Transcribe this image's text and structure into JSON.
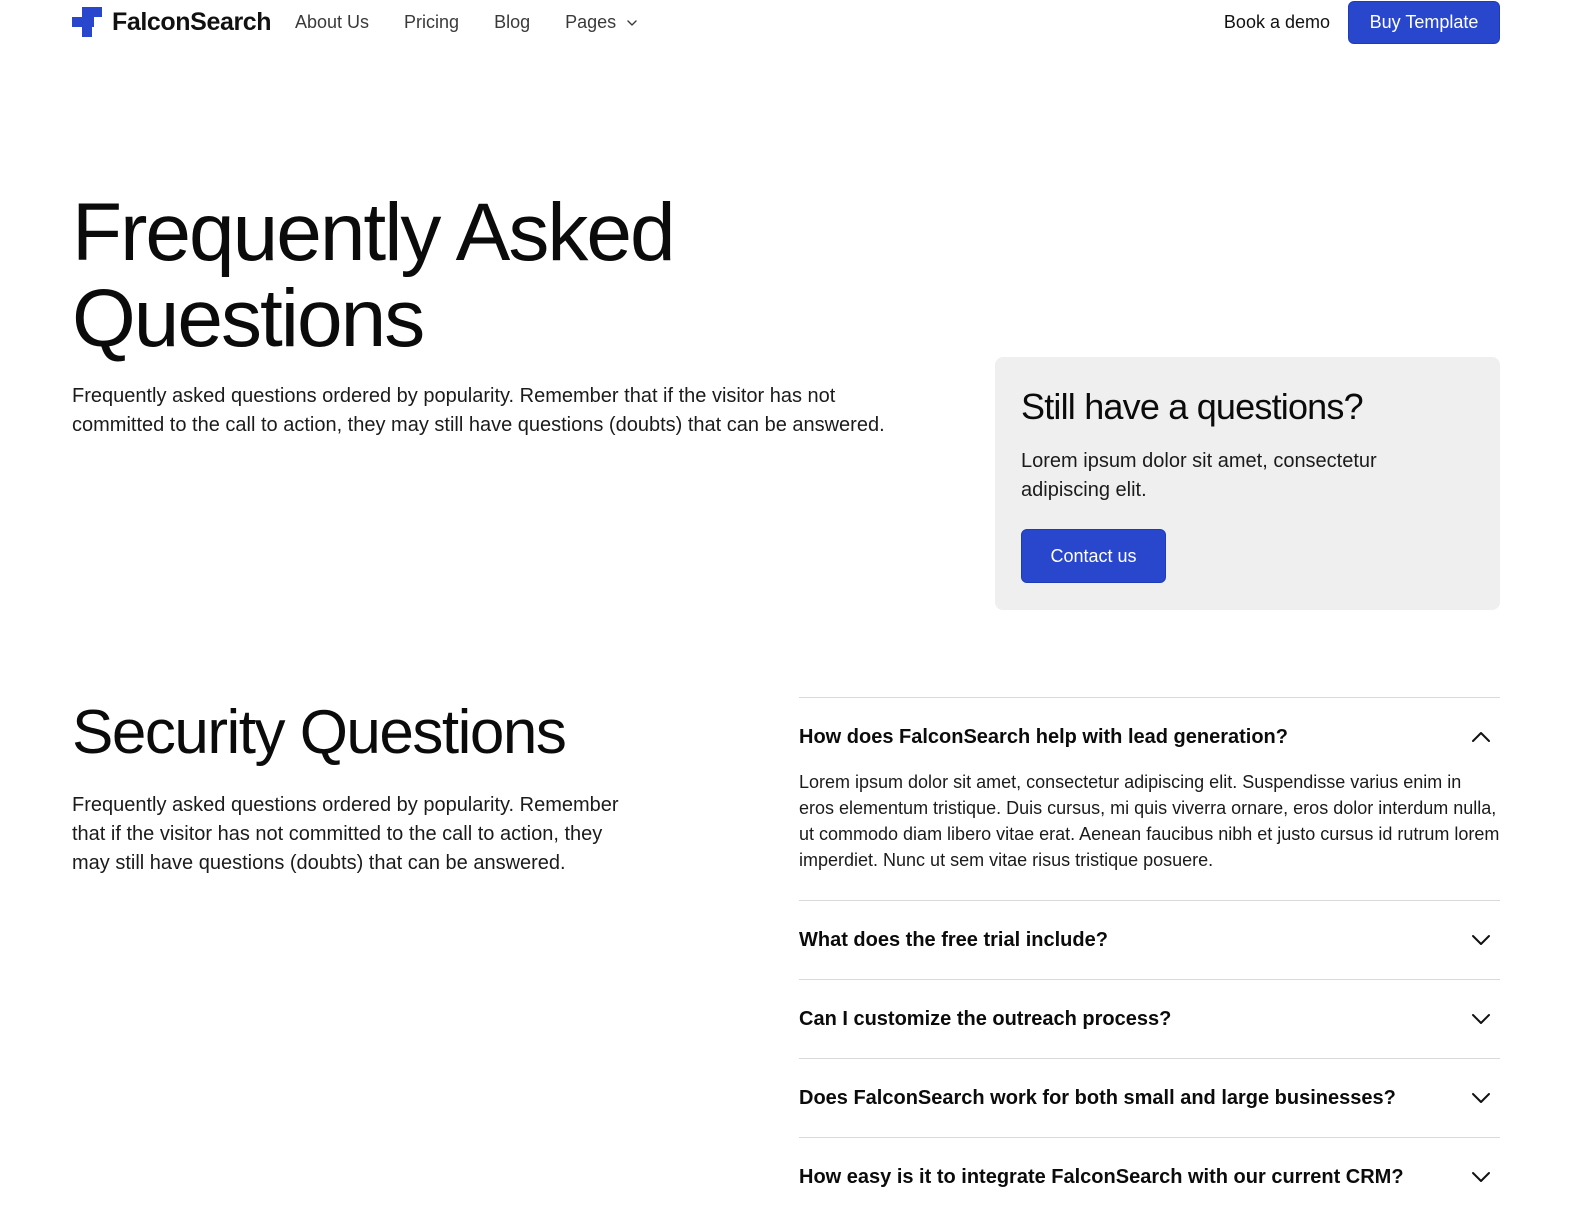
{
  "nav": {
    "brand": "FalconSearch",
    "links": [
      {
        "label": "About Us"
      },
      {
        "label": "Pricing"
      },
      {
        "label": "Blog"
      },
      {
        "label": "Pages",
        "has_dropdown": true
      }
    ],
    "demo_label": "Book a demo",
    "buy_label": "Buy Template"
  },
  "hero": {
    "title_line1": "Frequently Asked",
    "title_line2": "Questions",
    "description": "Frequently asked questions ordered by popularity. Remember that if the visitor has not committed to the call to action, they may still have questions (doubts) that can be answered."
  },
  "cta": {
    "title": "Still have a questions?",
    "description": "Lorem ipsum dolor sit amet, consectetur adipiscing elit.",
    "button_label": "Contact us"
  },
  "security": {
    "title": "Security Questions",
    "description": "Frequently asked questions ordered by popularity. Remember that if the visitor has not committed to the call to action, they may still have questions (doubts) that can be answered.",
    "faqs": [
      {
        "question": "How does FalconSearch help with lead generation?",
        "expanded": true,
        "answer": "Lorem ipsum dolor sit amet, consectetur adipiscing elit. Suspendisse varius enim in eros elementum tristique. Duis cursus, mi quis viverra ornare, eros dolor interdum nulla, ut commodo diam libero vitae erat. Aenean faucibus nibh et justo cursus id rutrum lorem imperdiet. Nunc ut sem vitae risus tristique posuere."
      },
      {
        "question": "What does the free trial include?",
        "expanded": false
      },
      {
        "question": "Can I customize the outreach process?",
        "expanded": false
      },
      {
        "question": "Does FalconSearch work for both small and large businesses?",
        "expanded": false
      },
      {
        "question": "How easy is it to integrate FalconSearch with our current CRM?",
        "expanded": false
      }
    ]
  },
  "colors": {
    "brand_blue": "#2847cc",
    "card_bg": "#efefef",
    "divider": "#d9d9d9"
  },
  "icons": {
    "logo": "falconsearch-logo-icon",
    "dropdown": "chevron-down-icon",
    "expanded": "chevron-up-icon",
    "collapsed": "chevron-down-icon"
  }
}
